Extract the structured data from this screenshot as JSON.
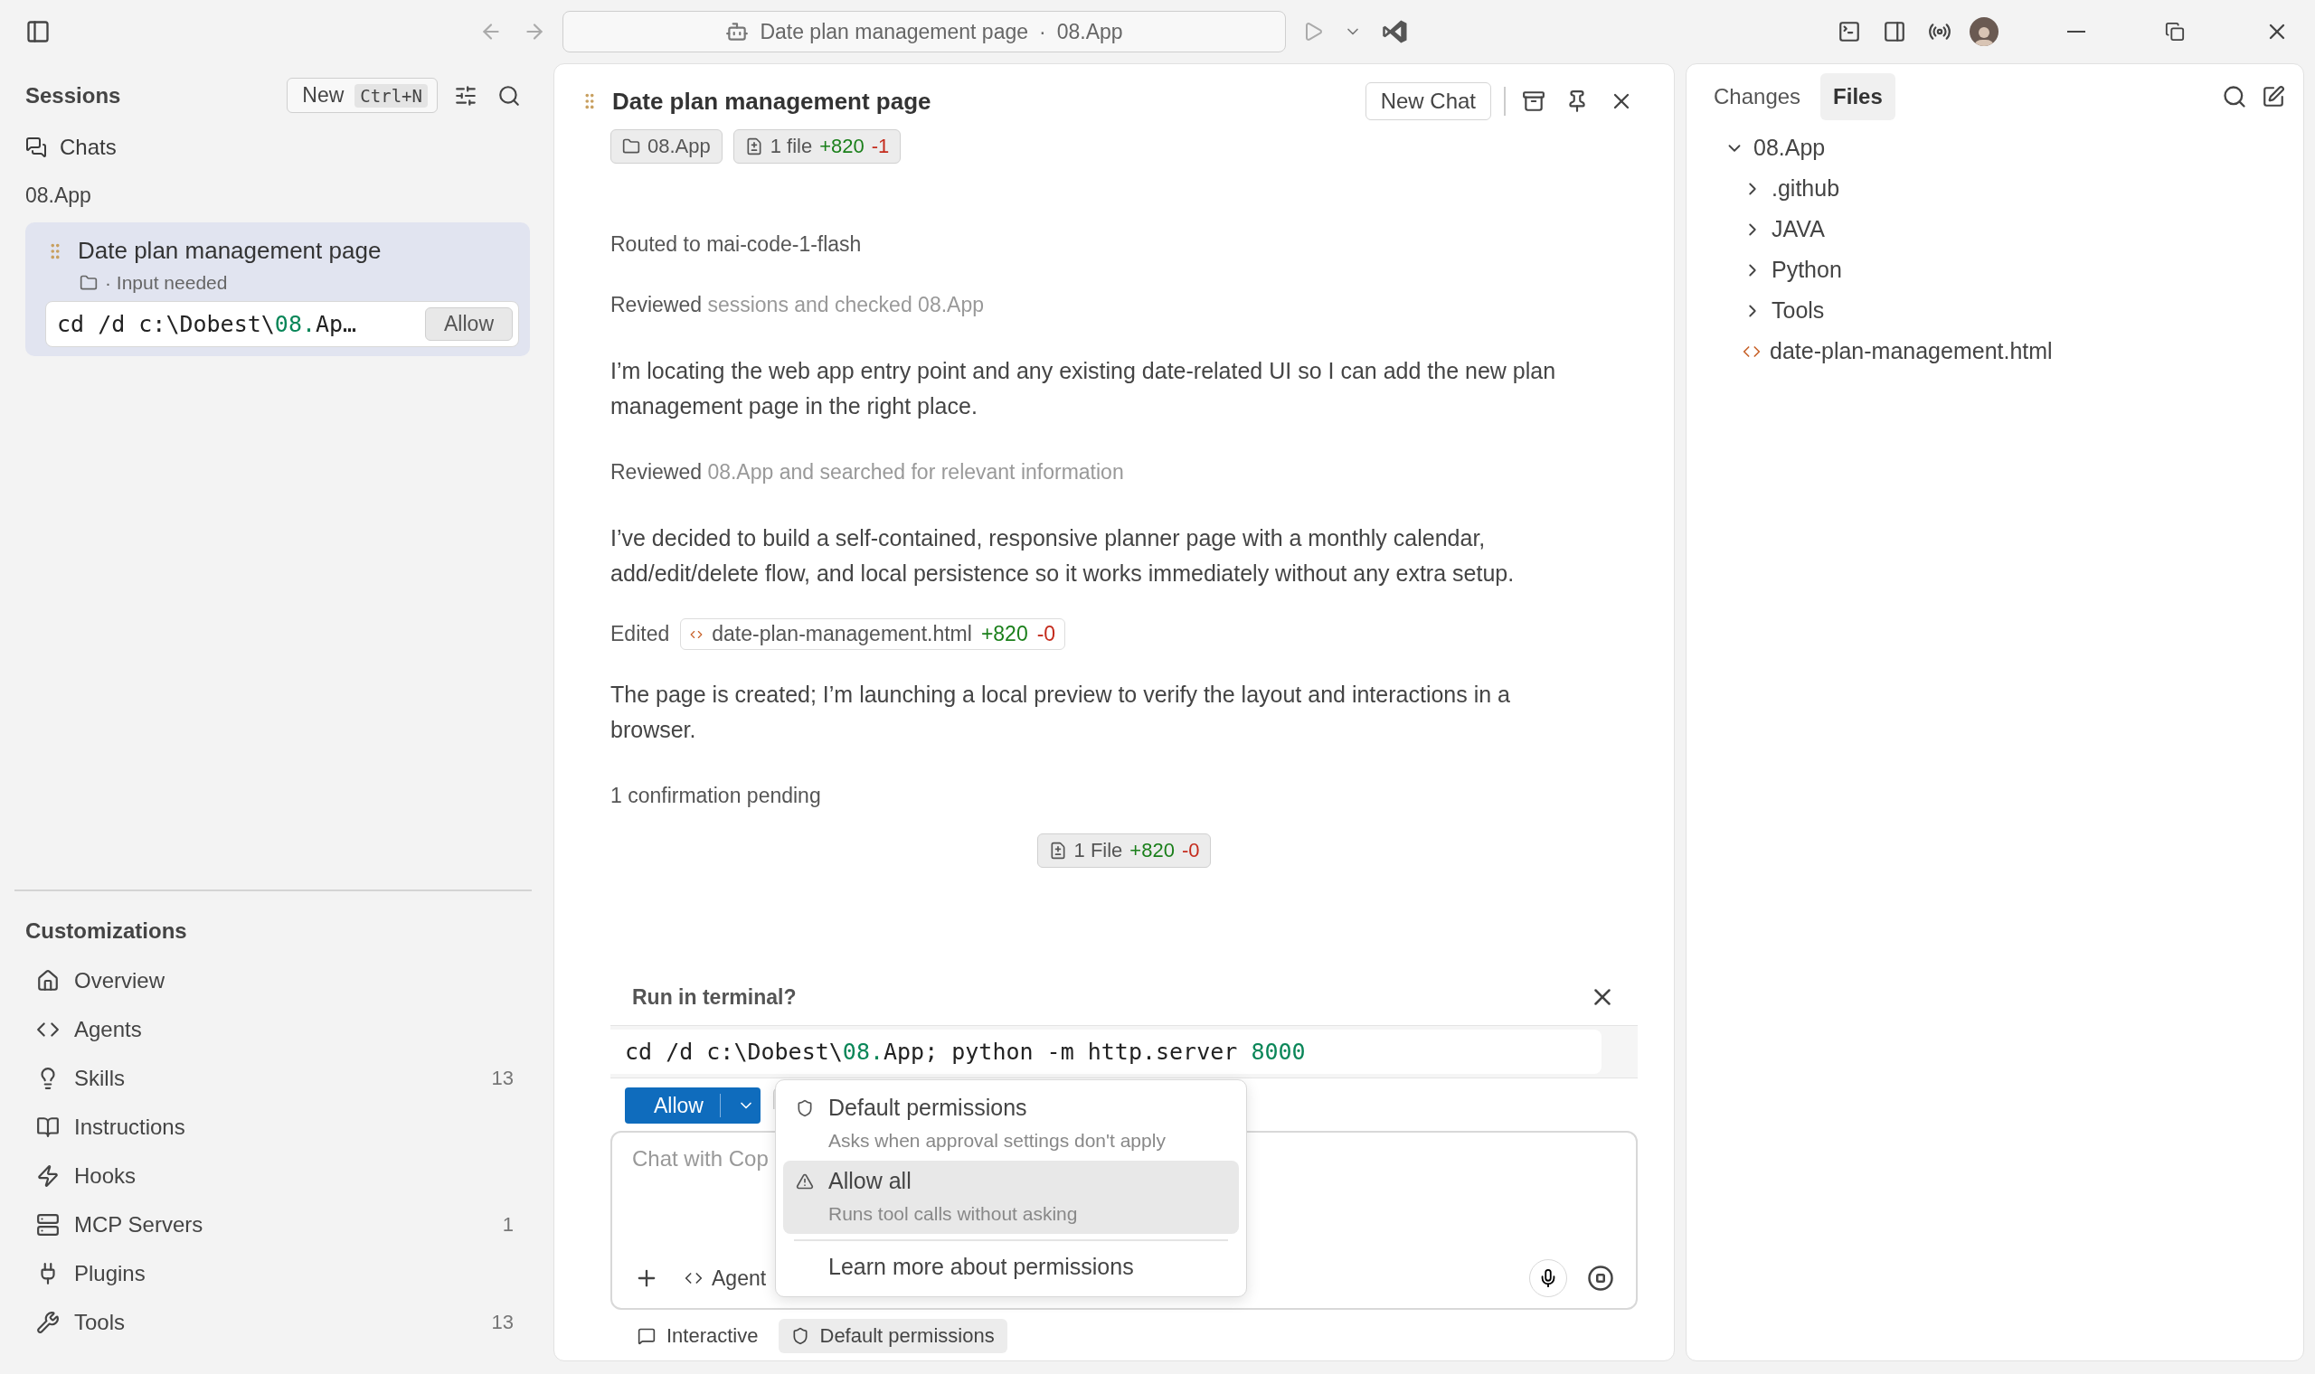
{
  "titlebar": {
    "title": "Date plan management page",
    "separator": "·",
    "workspace": "08.App"
  },
  "sessions": {
    "title": "Sessions",
    "new_label": "New",
    "new_shortcut": "Ctrl+N",
    "chats_label": "Chats",
    "group": "08.App",
    "items": [
      {
        "title": "Date plan management page",
        "status": "· Input needed",
        "selected": true,
        "action": "Allow",
        "command": [
          {
            "text": "cd /d c:\\Dobest\\",
            "kind": "plain"
          },
          {
            "text": "08.",
            "kind": "number"
          },
          {
            "text": "Ap…",
            "kind": "plain"
          }
        ]
      }
    ]
  },
  "customizations": {
    "title": "Customizations",
    "items": [
      {
        "label": "Overview",
        "kind": "home"
      },
      {
        "label": "Agents",
        "kind": "agent"
      },
      {
        "label": "Skills",
        "kind": "bulb",
        "count": "13"
      },
      {
        "label": "Instructions",
        "kind": "book"
      },
      {
        "label": "Hooks",
        "kind": "bolt"
      },
      {
        "label": "MCP Servers",
        "kind": "server",
        "count": "1"
      },
      {
        "label": "Plugins",
        "kind": "plug"
      },
      {
        "label": "Tools",
        "kind": "tools",
        "count": "13"
      }
    ]
  },
  "chat": {
    "title": "Date plan management page",
    "new_chat": "New Chat",
    "chips": [
      {
        "kind": "folder",
        "label": "08.App"
      },
      {
        "kind": "diff",
        "label": "1 file",
        "added": "+820",
        "removed": "-1"
      }
    ],
    "messages": [
      {
        "kind": "status",
        "text": "Routed to mai-code-1-flash"
      },
      {
        "kind": "activity",
        "verb": "Reviewed",
        "detail": "sessions and checked 08.App"
      },
      {
        "kind": "paragraph",
        "text": "I’m locating the web app entry point and any existing date-related UI so I can add the new plan management page in the right place."
      },
      {
        "kind": "activity",
        "verb": "Reviewed",
        "detail": "08.App and searched for relevant information"
      },
      {
        "kind": "paragraph",
        "text": "I’ve decided to build a self-contained, responsive planner page with a monthly calendar, add/edit/delete flow, and local persistence so it works immediately without any extra setup."
      },
      {
        "kind": "edit",
        "verb": "Edited",
        "file": "date-plan-management.html",
        "added": "+820",
        "removed": "-0"
      },
      {
        "kind": "paragraph",
        "text": "The page is created; I’m launching a local preview to verify the layout and interactions in a browser."
      },
      {
        "kind": "status",
        "text": "1 confirmation pending"
      }
    ],
    "files_chip": {
      "label": "1 File",
      "added": "+820",
      "removed": "-0"
    },
    "terminal": {
      "title": "Run in terminal?",
      "allow": "Allow",
      "command": [
        {
          "text": "cd /d c:\\Dobest\\",
          "kind": "plain"
        },
        {
          "text": "08.",
          "kind": "number"
        },
        {
          "text": "App; python -m http.server ",
          "kind": "plain"
        },
        {
          "text": "8000",
          "kind": "number"
        }
      ]
    },
    "composer": {
      "placeholder": "Chat with Cop",
      "mode": "Agent"
    },
    "menu": {
      "items": [
        {
          "label": "Default permissions",
          "description": "Asks when approval settings don't apply",
          "kind": "shield",
          "selected": false
        },
        {
          "label": "Allow all",
          "description": "Runs tool calls without asking",
          "kind": "warning",
          "selected": true
        }
      ],
      "link": "Learn more about permissions"
    },
    "footer": [
      {
        "label": "Interactive",
        "kind": "chat",
        "selected": false
      },
      {
        "label": "Default permissions",
        "kind": "shield",
        "selected": true
      }
    ]
  },
  "files": {
    "tabs": [
      {
        "label": "Changes",
        "selected": false
      },
      {
        "label": "Files",
        "selected": true
      }
    ],
    "tree": {
      "label": "08.App",
      "expanded": true,
      "children": [
        {
          "label": ".github",
          "kind": "folder",
          "expanded": false
        },
        {
          "label": "JAVA",
          "kind": "folder",
          "expanded": false
        },
        {
          "label": "Python",
          "kind": "folder",
          "expanded": false
        },
        {
          "label": "Tools",
          "kind": "folder",
          "expanded": false
        },
        {
          "label": "date-plan-management.html",
          "kind": "file"
        }
      ]
    }
  }
}
